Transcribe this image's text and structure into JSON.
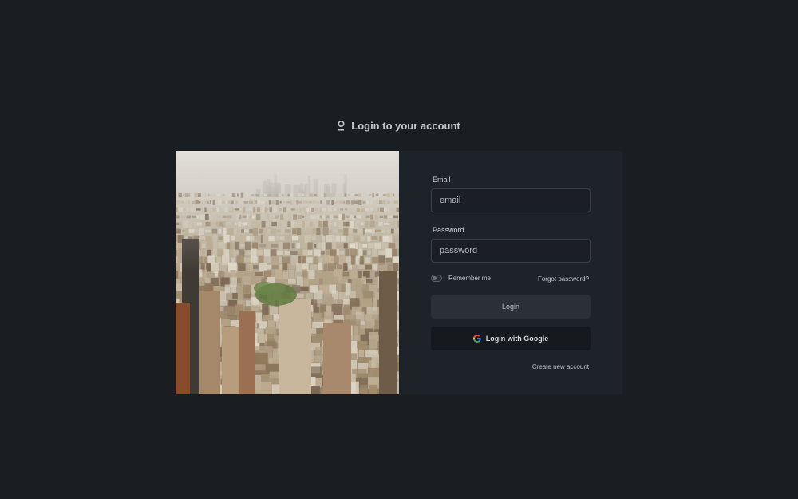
{
  "heading": {
    "icon": "user-pin-icon",
    "title": "Login to your account"
  },
  "form": {
    "email_label": "Email",
    "email_placeholder": "email",
    "password_label": "Password",
    "password_placeholder": "password",
    "remember_label": "Remember me",
    "remember_checked": false,
    "forgot_label": "Forgot password?",
    "login_label": "Login",
    "google_label": "Login with Google",
    "google_icon": "google-g-icon",
    "create_label": "Create new account"
  },
  "photo": {
    "subject": "city-skyline-aerial-image"
  },
  "colors": {
    "background": "#1a1d22",
    "card": "#1e2229",
    "login_button": "#2a2f38",
    "google_button": "#16191e"
  }
}
